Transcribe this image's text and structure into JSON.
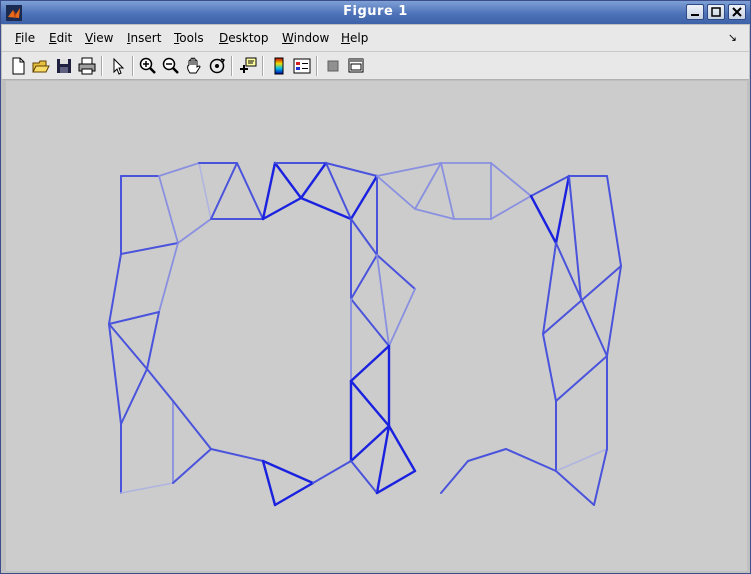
{
  "window": {
    "title": "Figure 1",
    "icon": "matlab-icon",
    "controls": [
      "minimize-icon",
      "maximize-icon",
      "close-icon"
    ]
  },
  "menu": {
    "items": [
      {
        "pre": "",
        "ul": "F",
        "post": "ile"
      },
      {
        "pre": "",
        "ul": "E",
        "post": "dit"
      },
      {
        "pre": "",
        "ul": "V",
        "post": "iew"
      },
      {
        "pre": "",
        "ul": "I",
        "post": "nsert"
      },
      {
        "pre": "",
        "ul": "T",
        "post": "ools"
      },
      {
        "pre": "",
        "ul": "D",
        "post": "esktop"
      },
      {
        "pre": "",
        "ul": "W",
        "post": "indow"
      },
      {
        "pre": "",
        "ul": "H",
        "post": "elp"
      }
    ],
    "dock_arrow": "↘"
  },
  "toolbar": {
    "buttons": [
      "new-figure-icon",
      "open-file-icon",
      "save-icon",
      "print-icon",
      "edit-plot-icon",
      "zoom-in-icon",
      "zoom-out-icon",
      "pan-icon",
      "rotate-3d-icon",
      "data-cursor-icon",
      "colorbar-icon",
      "legend-icon",
      "hide-plot-tools-icon",
      "show-plot-tools-icon"
    ]
  },
  "plot": {
    "colors": {
      "strong": "#1a22e0",
      "medium": "#4a53dc",
      "light": "#8a90e0",
      "faint": "#b0b4e0"
    }
  }
}
